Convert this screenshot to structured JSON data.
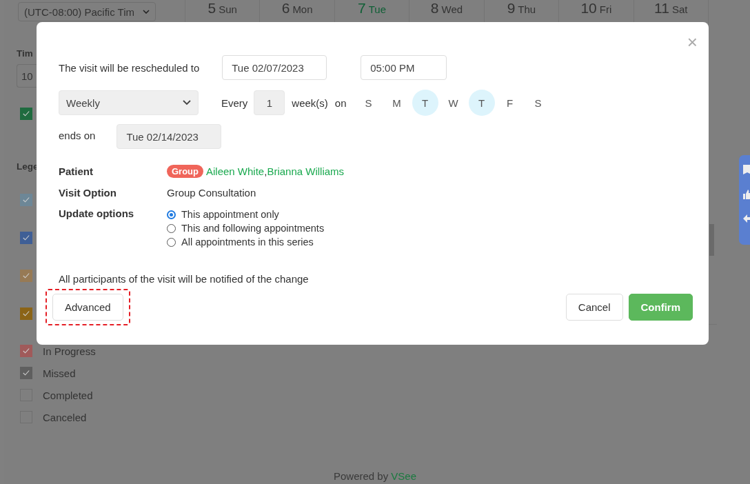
{
  "sidebar": {
    "timezone": "(UTC-08:00) Pacific Tim",
    "time_heading": "Tim",
    "time_value": "10",
    "extra_checkbox": {
      "checked": true,
      "color": "#1f6b3f"
    },
    "legend_heading": "Lege",
    "legend": [
      {
        "checked": true,
        "color": "#6d8797"
      },
      {
        "checked": true,
        "color": "#3f5f96"
      },
      {
        "checked": true,
        "color": "#977a55"
      },
      {
        "checked": true,
        "color": "#8b6417"
      },
      {
        "label": "In Progress",
        "checked": true,
        "color": "#a05a5a"
      },
      {
        "label": "Missed",
        "checked": true,
        "color": "#5f5f5f"
      },
      {
        "label": "Completed",
        "checked": false
      },
      {
        "label": "Canceled",
        "checked": false
      }
    ]
  },
  "calendar": {
    "days": [
      {
        "number": "5",
        "weekday": "Sun",
        "selected": false
      },
      {
        "number": "6",
        "weekday": "Mon",
        "selected": false
      },
      {
        "number": "7",
        "weekday": "Tue",
        "selected": true
      },
      {
        "number": "8",
        "weekday": "Wed",
        "selected": false
      },
      {
        "number": "9",
        "weekday": "Thu",
        "selected": false
      },
      {
        "number": "10",
        "weekday": "Fri",
        "selected": false
      },
      {
        "number": "11",
        "weekday": "Sat",
        "selected": false
      }
    ]
  },
  "dialog": {
    "close": "×",
    "reschedule_label": "The visit will be rescheduled to",
    "date": "Tue 02/07/2023",
    "time": "05:00 PM",
    "repeat": "Weekly",
    "every_label": "Every",
    "interval": "1",
    "unit_label": "week(s)",
    "on_label": "on",
    "weekdays": [
      {
        "label": "S",
        "selected": false
      },
      {
        "label": "M",
        "selected": false
      },
      {
        "label": "T",
        "selected": true
      },
      {
        "label": "W",
        "selected": false
      },
      {
        "label": "T",
        "selected": true
      },
      {
        "label": "F",
        "selected": false
      },
      {
        "label": "S",
        "selected": false
      }
    ],
    "ends_label": "ends on",
    "end_date": "Tue 02/14/2023",
    "patient_label": "Patient",
    "group_badge": "Group",
    "patients": [
      {
        "name": "Aileen White",
        "separator": ","
      },
      {
        "name": "Brianna Williams"
      }
    ],
    "visit_option_label": "Visit Option",
    "visit_option": "Group Consultation",
    "update_label": "Update options",
    "update_options": [
      {
        "label": "This appointment only",
        "selected": true
      },
      {
        "label": "This and following appointments",
        "selected": false
      },
      {
        "label": "All appointments in this series",
        "selected": false
      }
    ],
    "notice": "All participants of the visit will be notified of the change",
    "advanced_button": {
      "label": "Advanced",
      "highlighted": true
    },
    "cancel_button": "Cancel",
    "confirm_button": "Confirm"
  },
  "footer": {
    "prefix": "Powered by",
    "brand": "VSee"
  }
}
